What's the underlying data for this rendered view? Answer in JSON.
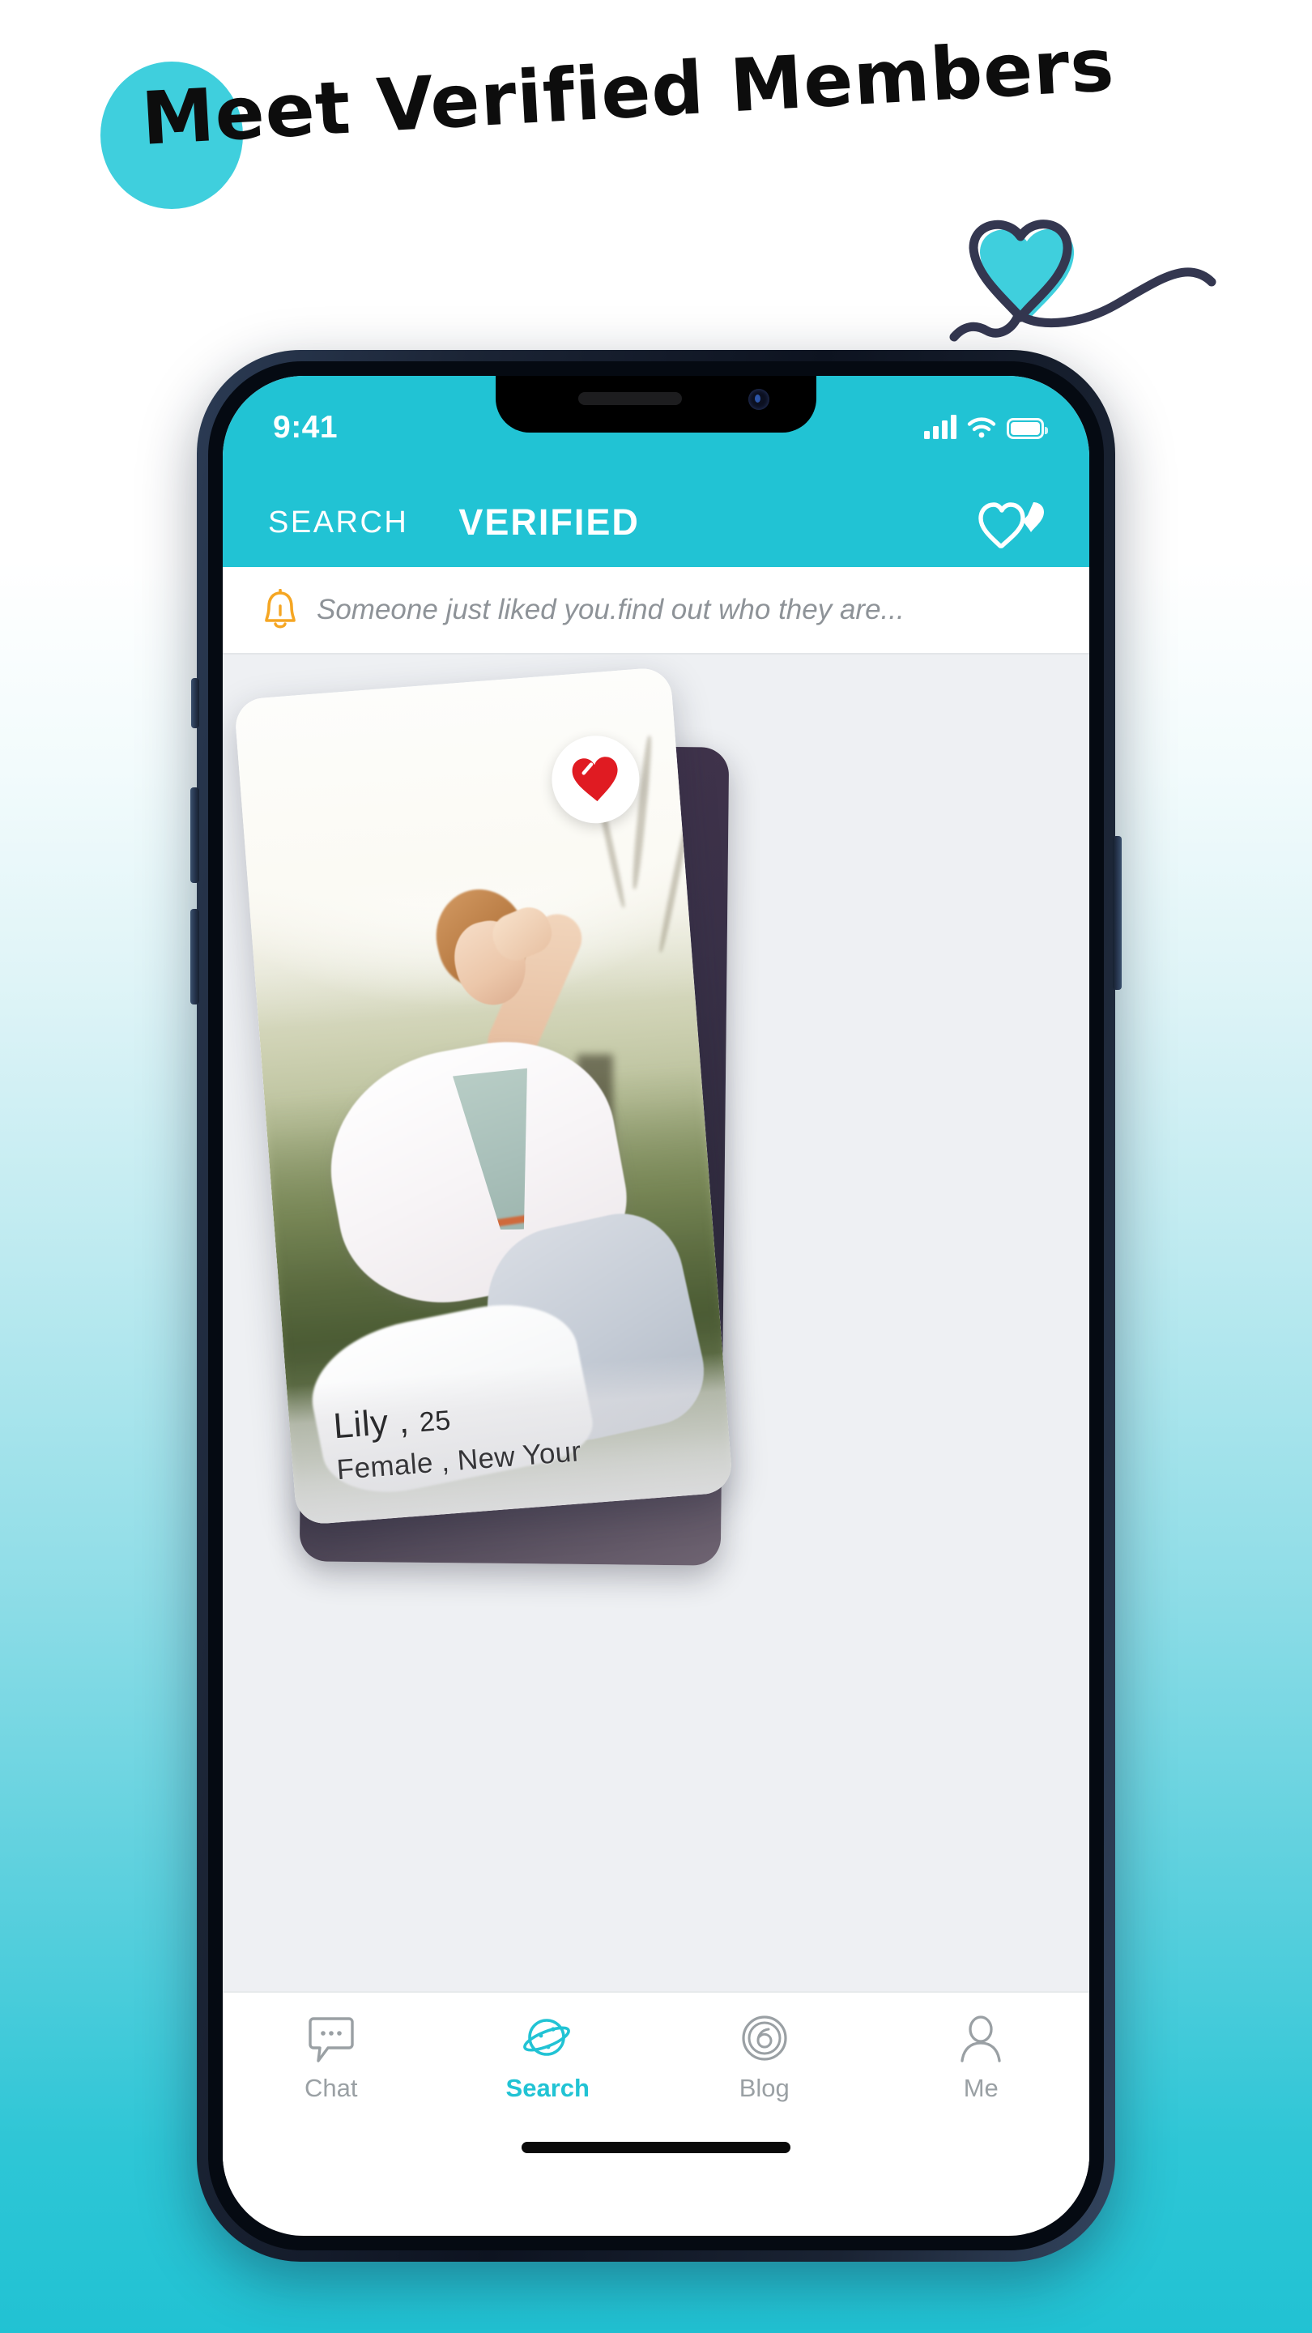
{
  "hero": {
    "headline": "Meet Verified Members",
    "blob_color": "#3fcfdd",
    "doodle_heart_fill": "#3fcfdd",
    "doodle_stroke": "#343750"
  },
  "phone": {
    "status_bar": {
      "time": "9:41",
      "signal_icon": "signal-bars-icon",
      "wifi_icon": "wifi-icon",
      "battery_icon": "battery-full-icon"
    },
    "app_header": {
      "background": "#21c3d4",
      "tab_search": "SEARCH",
      "tab_verified": "VERIFIED",
      "hearts_icon": "double-heart-icon"
    },
    "notification": {
      "bell_icon": "bell-icon",
      "bell_color": "#f5a623",
      "text": "Someone just liked you.find out who they are..."
    },
    "card": {
      "like_icon": "heart-filled-icon",
      "like_color": "#e01b22",
      "name": "Lily ,",
      "age": "25",
      "meta": "Female , New Your"
    },
    "tabbar": {
      "items": [
        {
          "label": "Chat",
          "icon": "chat-bubble-icon",
          "active": false
        },
        {
          "label": "Search",
          "icon": "planet-icon",
          "active": true
        },
        {
          "label": "Blog",
          "icon": "spiral-six-icon",
          "active": false
        },
        {
          "label": "Me",
          "icon": "person-icon",
          "active": false
        }
      ],
      "active_color": "#21c3d4",
      "inactive_color": "#9aa0a4"
    }
  }
}
